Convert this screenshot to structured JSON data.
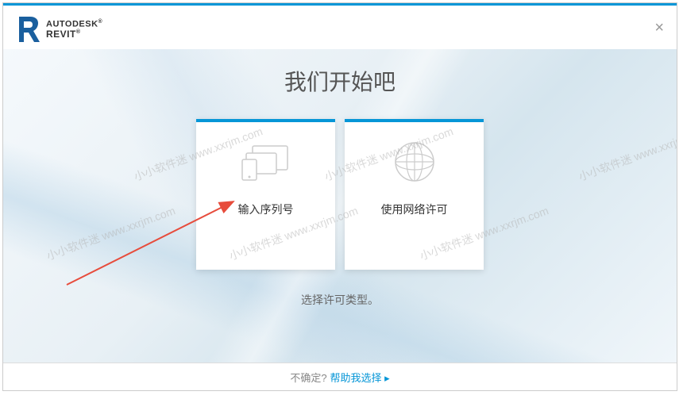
{
  "header": {
    "brand": "AUTODESK",
    "product": "REVIT",
    "brand_mark": "®",
    "product_mark": "®"
  },
  "main": {
    "title": "我们开始吧",
    "subtitle": "选择许可类型。",
    "cards": [
      {
        "label": "输入序列号",
        "icon": "devices-icon"
      },
      {
        "label": "使用网络许可",
        "icon": "network-icon"
      }
    ]
  },
  "footer": {
    "prompt": "不确定?",
    "link": "帮助我选择 ▸"
  },
  "watermark_text": "小小软件迷 www.xxrjm.com"
}
